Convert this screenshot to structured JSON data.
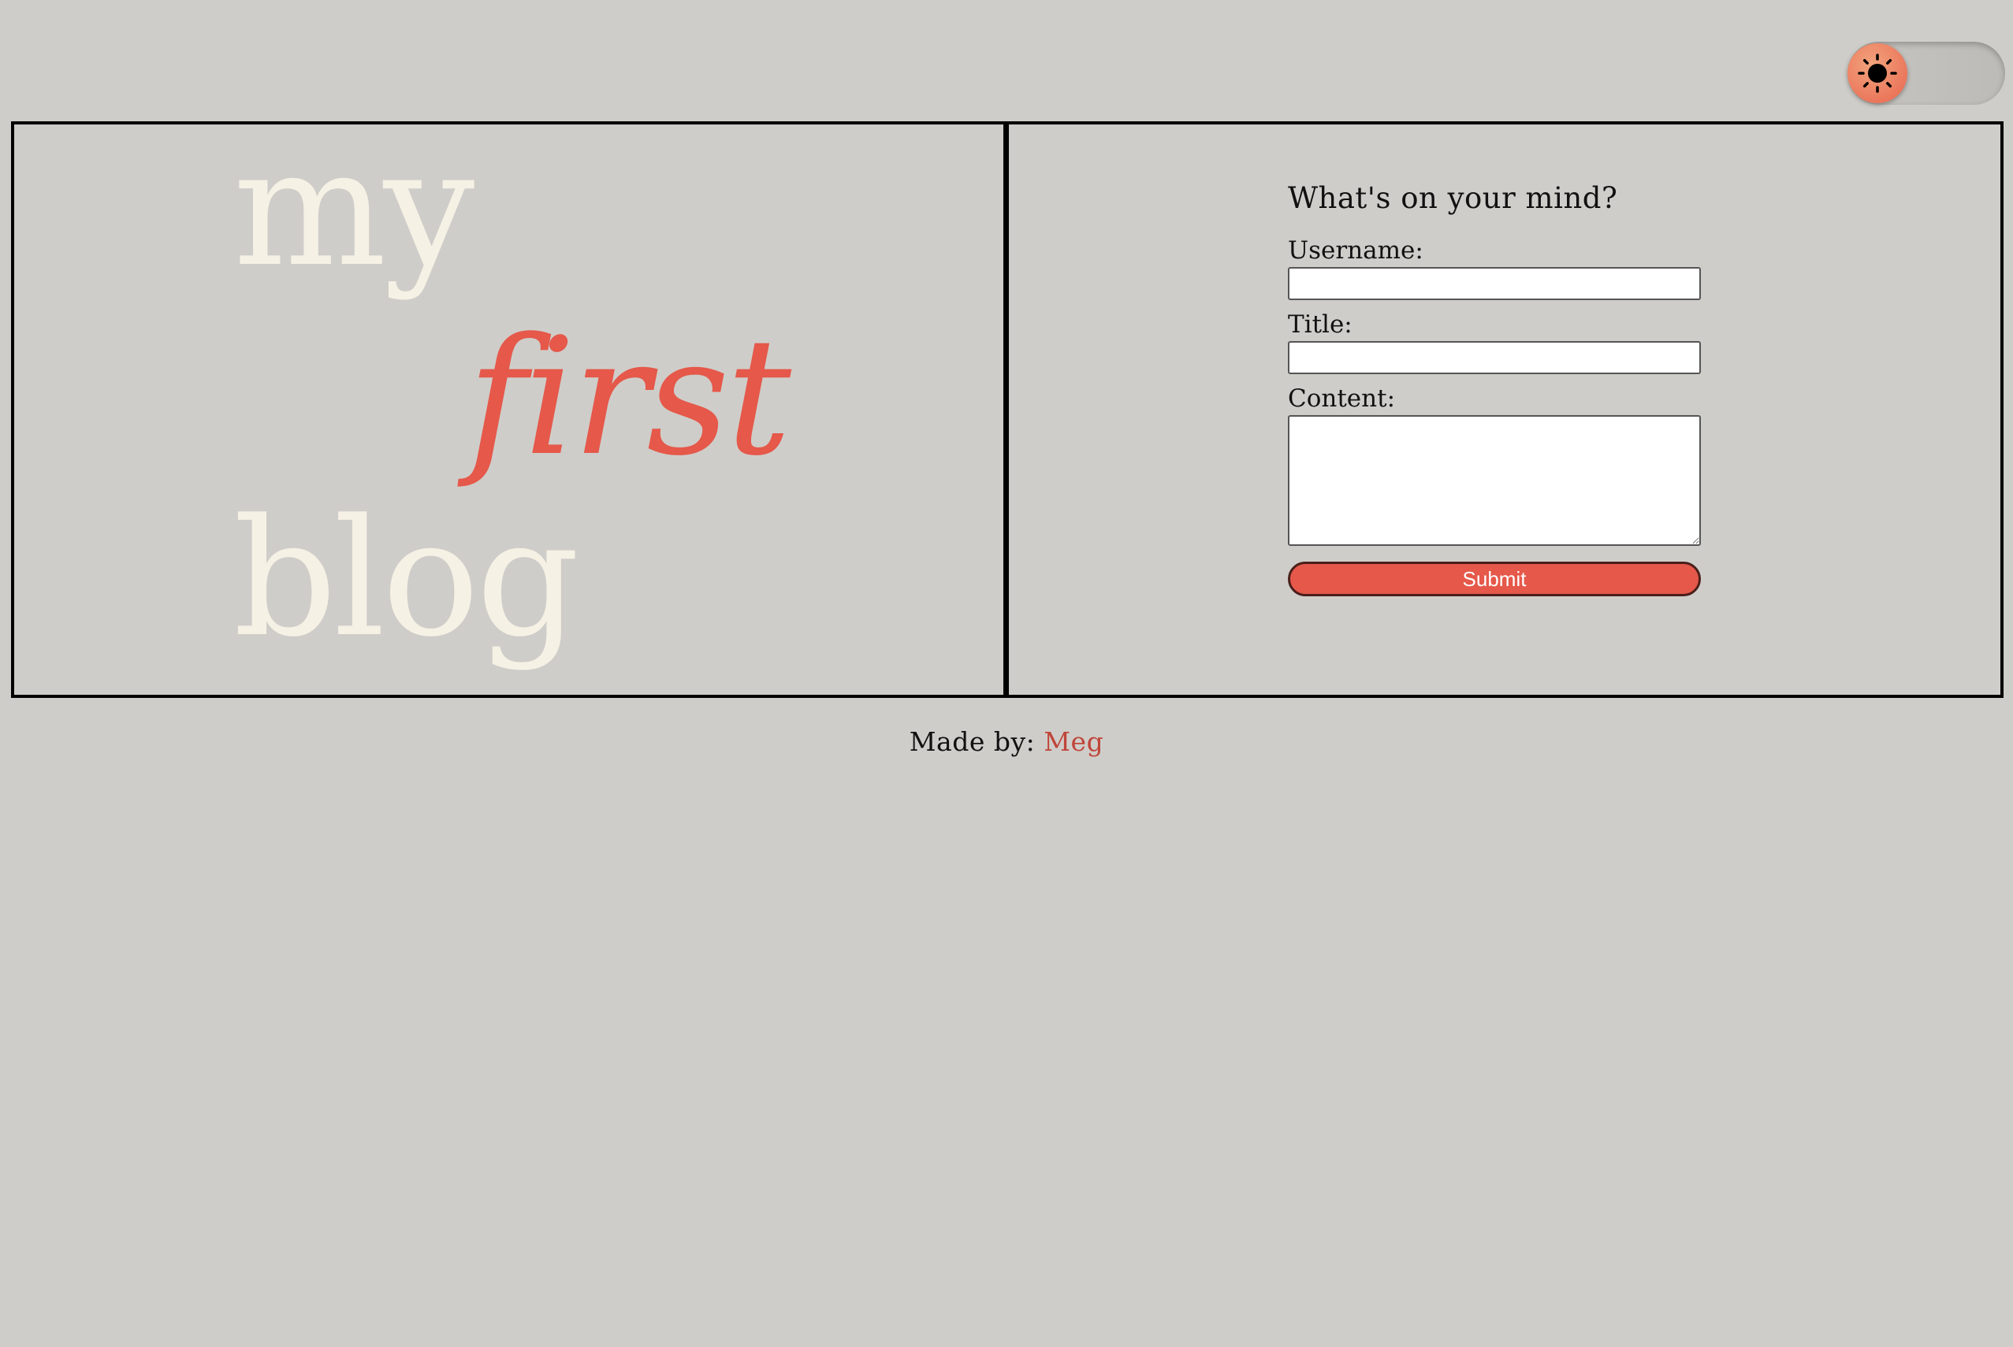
{
  "theme_toggle": {
    "icon": "sun-icon",
    "state": "light"
  },
  "logo": {
    "word1": "my",
    "word2": "first",
    "word3": "blog"
  },
  "form": {
    "heading": "What's on your mind?",
    "username_label": "Username:",
    "username_value": "",
    "title_label": "Title:",
    "title_value": "",
    "content_label": "Content:",
    "content_value": "",
    "submit_label": "Submit"
  },
  "footer": {
    "prefix": "Made by:",
    "author": "Meg"
  },
  "colors": {
    "background": "#cfcdc9",
    "accent": "#e5584a",
    "cream": "#f6f1e5",
    "link": "#c0453a"
  }
}
